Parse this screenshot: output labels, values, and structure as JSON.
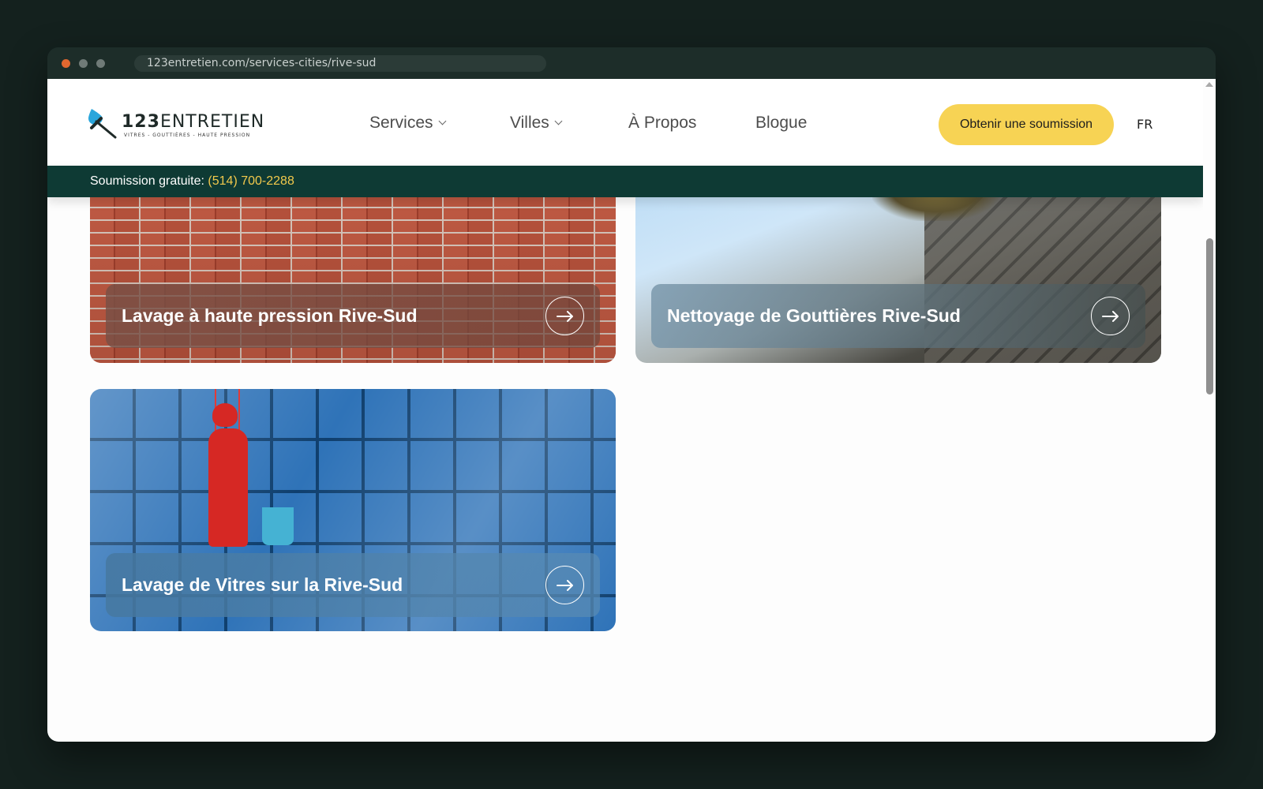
{
  "browser": {
    "url": "123entretien.com/services-cities/rive-sud"
  },
  "header": {
    "logo": {
      "brand_bold": "123",
      "brand_rest": "ENTRETIEN",
      "tagline": "VITRES - GOUTTIÈRES - HAUTE PRESSION"
    },
    "nav": [
      {
        "label": "Services",
        "has_dropdown": true
      },
      {
        "label": "Villes",
        "has_dropdown": true
      },
      {
        "label": "À Propos",
        "has_dropdown": false
      },
      {
        "label": "Blogue",
        "has_dropdown": false
      }
    ],
    "cta_label": "Obtenir une soumission",
    "language": "FR"
  },
  "promo": {
    "label": "Soumission gratuite:",
    "phone": "(514) 700-2288"
  },
  "cards": [
    {
      "title": "Lavage à haute pression Rive-Sud",
      "image": "brick-wall-photo"
    },
    {
      "title": "Nettoyage de Gouttières Rive-Sud",
      "image": "gutter-roof-photo"
    },
    {
      "title": "Lavage de Vitres sur la Rive-Sud",
      "image": "window-washer-photo"
    }
  ],
  "icons": {
    "card_arrow": "arrow-right-icon",
    "dropdown": "chevron-down-icon",
    "logo": "squeegee-drop-icon"
  },
  "colors": {
    "accent": "#f7d354",
    "promo_bg": "#0e3a34",
    "phone": "#f2c94c",
    "logo_blue": "#2aa6dc"
  }
}
